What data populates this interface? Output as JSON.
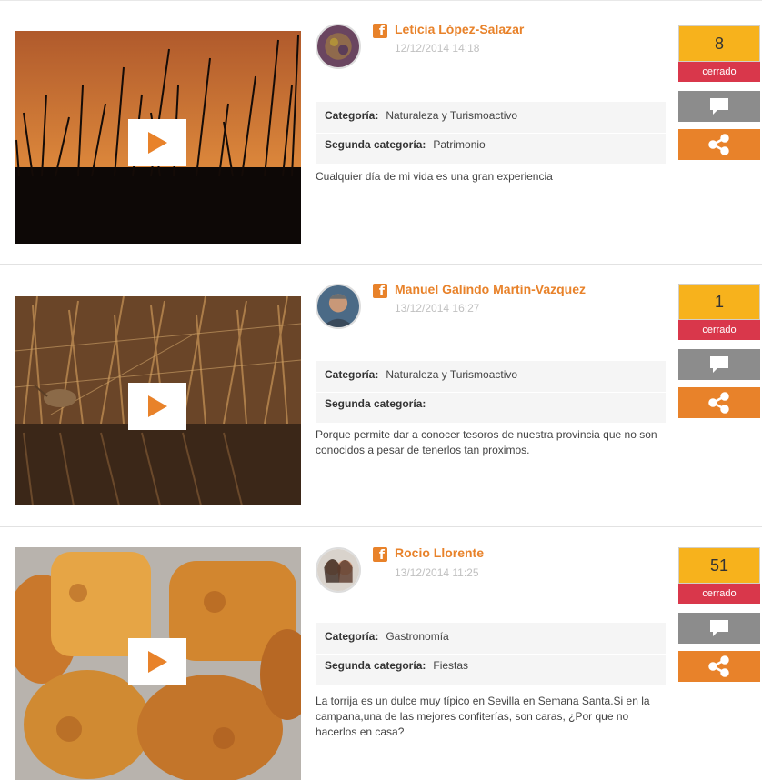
{
  "entries": [
    {
      "author": "Leticia López-Salazar",
      "date": "12/12/2014 14:18",
      "category_label": "Categoría:",
      "category": "Naturaleza y Turismoactivo",
      "second_category_label": "Segunda categoría:",
      "second_category": "Patrimonio",
      "description": "Cualquier día de mi vida es una gran experiencia",
      "votes": "8",
      "status": "cerrado"
    },
    {
      "author": "Manuel Galindo Martín-Vazquez",
      "date": "13/12/2014 16:27",
      "category_label": "Categoría:",
      "category": "Naturaleza y Turismoactivo",
      "second_category_label": "Segunda categoría:",
      "second_category": "",
      "description": "Porque permite dar a conocer tesoros de nuestra provincia que no son conocidos a pesar de tenerlos tan proximos.",
      "votes": "1",
      "status": "cerrado"
    },
    {
      "author": "Rocio Llorente",
      "date": "13/12/2014 11:25",
      "category_label": "Categoría:",
      "category": "Gastronomía",
      "second_category_label": "Segunda categoría:",
      "second_category": "Fiestas",
      "description": "La torrija es un dulce muy típico en Sevilla en Semana Santa.Si en la campana,una de las mejores confiterías, son caras, ¿Por que no hacerlos en casa?",
      "votes": "51",
      "status": "cerrado"
    }
  ],
  "icons": {
    "play": "play-icon",
    "facebook": "facebook-icon",
    "comment": "comment-icon",
    "share": "share-icon"
  },
  "colors": {
    "accent": "#e8822a",
    "vote": "#f7b21c",
    "status": "#d9374b",
    "comment": "#8c8c8c"
  }
}
